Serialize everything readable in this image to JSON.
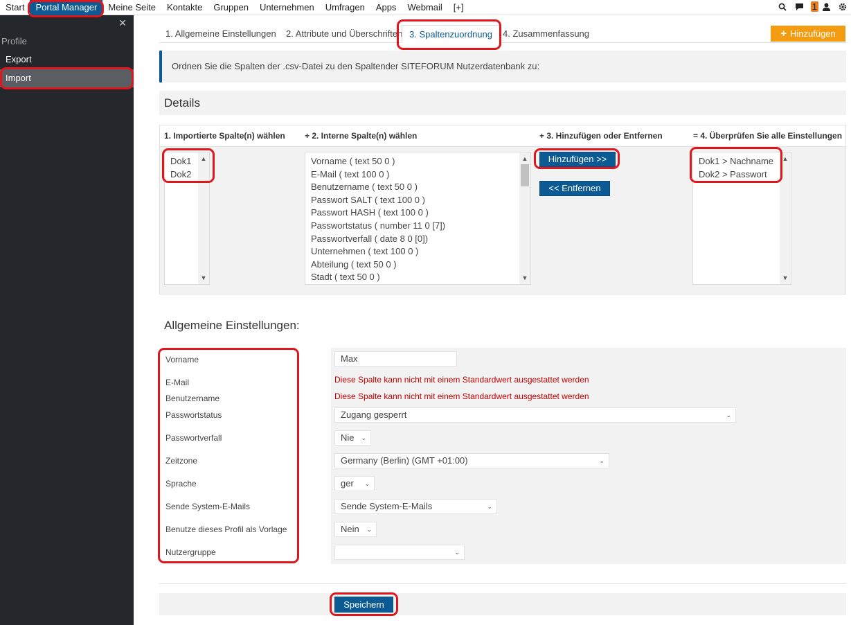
{
  "topnav": {
    "items": [
      "Start",
      "Portal Manager",
      "Meine Seite",
      "Kontakte",
      "Gruppen",
      "Unternehmen",
      "Umfragen",
      "Apps",
      "Webmail",
      "[+]"
    ],
    "badge": "1"
  },
  "sidebar": {
    "heading": "Profile",
    "items": [
      "Export",
      "Import"
    ]
  },
  "tabs": [
    "1. Allgemeine Einstellungen",
    "2. Attribute und Überschriften",
    "3. Spaltenzuordnung",
    "4. Zusammenfassung"
  ],
  "add_button": "Hinzufügen",
  "info_text": "Ordnen Sie die Spalten der .csv-Datei zu den Spaltender SITEFORUM Nutzerdatenbank zu:",
  "details": {
    "title": "Details",
    "col1": "1. Importierte Spalte(n) wählen",
    "col2": "+ 2. Interne Spalte(n) wählen",
    "col3": "+ 3. Hinzufügen oder Entfernen",
    "col4": "= 4. Überprüfen Sie alle Einstellungen",
    "imported": [
      "Dok1",
      "Dok2"
    ],
    "internal": [
      "Vorname ( text 50 0 )",
      "E-Mail ( text 100 0 )",
      "Benutzername ( text 50 0 )",
      "Passwort SALT ( text 100 0 )",
      "Passwort HASH ( text 100 0 )",
      "Passwortstatus ( number 11 0 [7])",
      "Passwortverfall ( date 8 0 [0])",
      "Unternehmen ( text 100 0 )",
      "Abteilung ( text 50 0 )",
      "Stadt ( text 50 0 )"
    ],
    "add_btn": "Hinzufügen >>",
    "remove_btn": "<< Entfernen",
    "mappings": [
      "Dok1 > Nachname",
      "Dok2 > Passwort"
    ]
  },
  "general": {
    "title": "Allgemeine Einstellungen:",
    "labels": {
      "vorname": "Vorname",
      "email": "E-Mail",
      "benutzername": "Benutzername",
      "passwortstatus": "Passwortstatus",
      "passwortverfall": "Passwortverfall",
      "zeitzone": "Zeitzone",
      "sprache": "Sprache",
      "sende": "Sende System-E-Mails",
      "vorlage": "Benutze dieses Profil als Vorlage",
      "nutzergruppe": "Nutzergruppe"
    },
    "values": {
      "vorname": "Max",
      "passwortstatus": "Zugang gesperrt",
      "passwortverfall": "Nie",
      "zeitzone": "Germany (Berlin) (GMT +01:00)",
      "sprache": "ger",
      "sende": "Sende System-E-Mails",
      "vorlage": "Nein",
      "nutzergruppe": ""
    },
    "error_text": "Diese Spalte kann nicht mit einem Standardwert ausgestattet werden"
  },
  "save_button": "Speichern"
}
